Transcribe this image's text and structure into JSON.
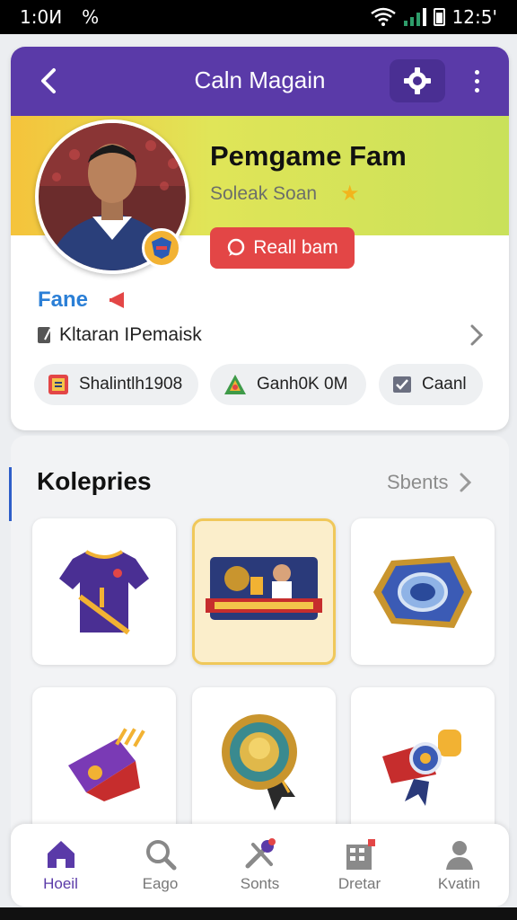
{
  "status_bar": {
    "time_left": "1:0И",
    "percent": "%",
    "time_right": "12:5'"
  },
  "header": {
    "title": "Caln Magain",
    "back_icon": "chevron-left-icon",
    "settings_icon": "gear-icon",
    "more_icon": "more-vertical-icon"
  },
  "profile": {
    "name": "Pemgame Fam",
    "subtitle": "Solеak Sоan",
    "cta_label": "Reall bam",
    "fan_label": "Fane",
    "info_text": "Kltaran IPemaisk"
  },
  "chips": [
    {
      "label": "Shalintlh1908",
      "icon": "team-flag-icon"
    },
    {
      "label": "Ganh0K 0M",
      "icon": "pyramid-icon"
    },
    {
      "label": "Caanl",
      "icon": "check-box-icon"
    }
  ],
  "collection": {
    "title": "Koleрries",
    "see_all": "Sbents",
    "items": [
      {
        "name": "jersey",
        "icon": "jersey-icon"
      },
      {
        "name": "match-card",
        "icon": "trading-card-icon"
      },
      {
        "name": "badge",
        "icon": "hex-badge-icon"
      },
      {
        "name": "scarf",
        "icon": "scarf-icon"
      },
      {
        "name": "medal",
        "icon": "medal-icon"
      },
      {
        "name": "trophy-ribbon",
        "icon": "ribbon-icon"
      }
    ]
  },
  "nav": [
    {
      "label": "Hoeil",
      "icon": "home-icon",
      "active": true
    },
    {
      "label": "Eago",
      "icon": "search-icon",
      "active": false
    },
    {
      "label": "Sonts",
      "icon": "tools-icon",
      "active": false
    },
    {
      "label": "Dretar",
      "icon": "building-icon",
      "active": false
    },
    {
      "label": "Kvatin",
      "icon": "user-icon",
      "active": false
    }
  ],
  "colors": {
    "primary": "#5a3aa8",
    "accent_red": "#e34646",
    "banner_yellow": "#f5c33b",
    "banner_green": "#c9e15a",
    "fan_blue": "#2b7fd6"
  }
}
